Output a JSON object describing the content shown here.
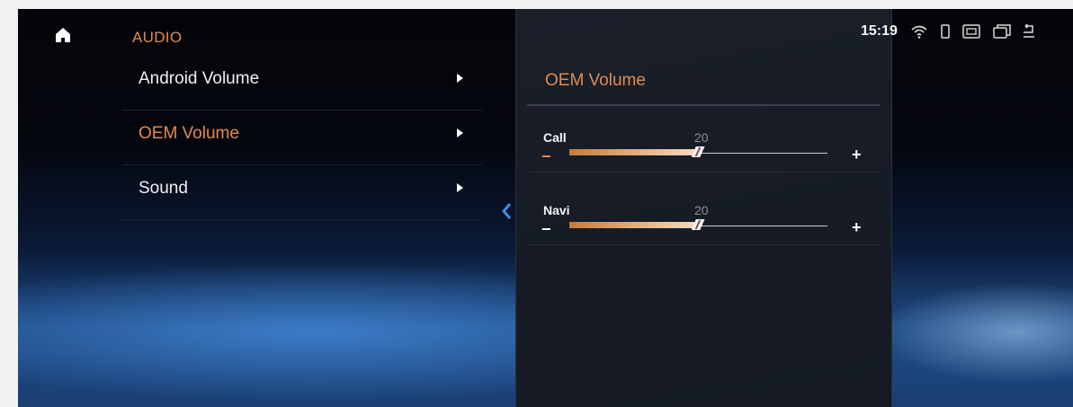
{
  "header": {
    "section_title": "AUDIO",
    "home_icon": "home-icon",
    "time": "15:19",
    "status_icons": [
      "wifi-icon",
      "phone-icon",
      "screen-icon",
      "window-icon",
      "back-icon"
    ]
  },
  "menu": {
    "items": [
      {
        "label": "Android Volume",
        "active": false
      },
      {
        "label": "OEM Volume",
        "active": true
      },
      {
        "label": "Sound",
        "active": false
      }
    ]
  },
  "panel": {
    "title": "OEM Volume",
    "rows": [
      {
        "name": "Call",
        "value": "20",
        "minus": "−",
        "plus": "+",
        "level": 0.5
      },
      {
        "name": "Navi",
        "value": "20",
        "minus": "−",
        "plus": "+",
        "level": 0.5
      }
    ]
  },
  "colors": {
    "accent": "#e38a4c",
    "panel_bg": "#171c26",
    "minus_active": "#e38a4c"
  }
}
